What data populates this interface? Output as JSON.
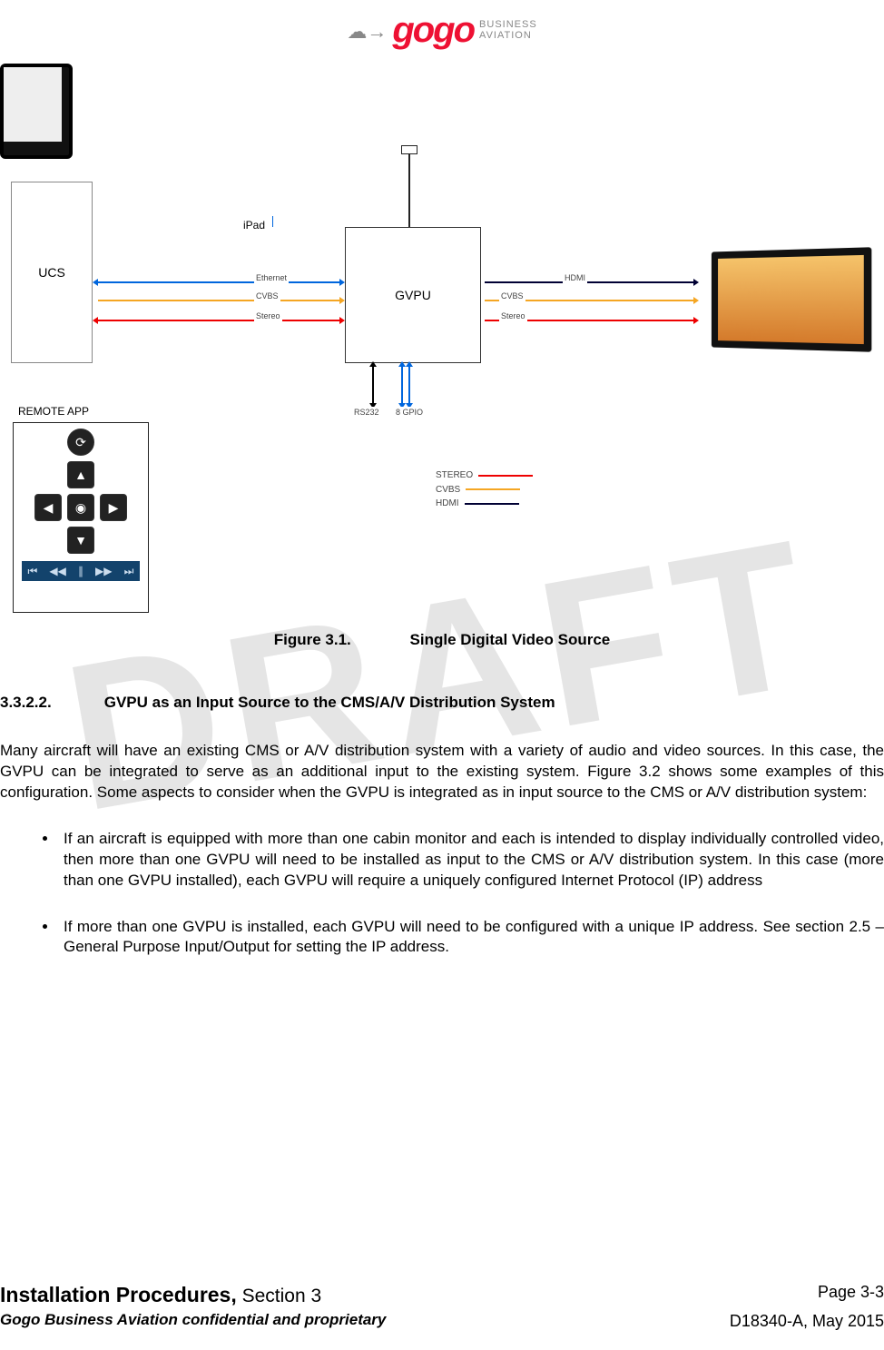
{
  "header": {
    "brand": "gogo",
    "brand_sub1": "BUSINESS",
    "brand_sub2": "AVIATION"
  },
  "diagram": {
    "ucs_label": "UCS",
    "gvpu_label": "GVPU",
    "ipad_label": "iPad",
    "remote_label": "REMOTE APP",
    "conn": {
      "ethernet": "Ethernet",
      "cvbs": "CVBS",
      "stereo": "Stereo",
      "hdmi": "HDMI",
      "rs232": "RS232",
      "gpio": "8 GPIO"
    },
    "legend": {
      "stereo": "STEREO",
      "cvbs": "CVBS",
      "hdmi": "HDMI"
    }
  },
  "figure": {
    "number": "Figure 3.1.",
    "title": "Single Digital Video Source"
  },
  "section": {
    "number": "3.3.2.2.",
    "title": "GVPU as an Input Source to the CMS/A/V Distribution System"
  },
  "paragraph": "Many aircraft will have an existing CMS or A/V distribution system with a variety of audio and video sources.  In this case, the GVPU can be integrated to serve as an additional input to the existing system.  Figure 3.2 shows some examples of this configuration.  Some aspects to consider when the GVPU is integrated as in input source to the CMS or A/V distribution system:",
  "bullets": [
    "If an aircraft is equipped with more than one cabin monitor and each is intended to display individually controlled video, then more than one GVPU will need to be installed as input to the CMS or A/V distribution system.  In this case (more than one GVPU installed), each GVPU will require a uniquely configured Internet Protocol (IP) address",
    "If more than one GVPU is installed, each GVPU will need to be configured with a unique IP address.  See section 2.5 – General Purpose Input/Output for setting the IP address."
  ],
  "footer": {
    "title_bold": "Installation Procedures,",
    "title_light": " Section 3",
    "page": "Page 3-3",
    "confidential": "Gogo Business Aviation confidential and proprietary",
    "docref": "D18340-A, May 2015"
  },
  "watermark": "DRAFT"
}
